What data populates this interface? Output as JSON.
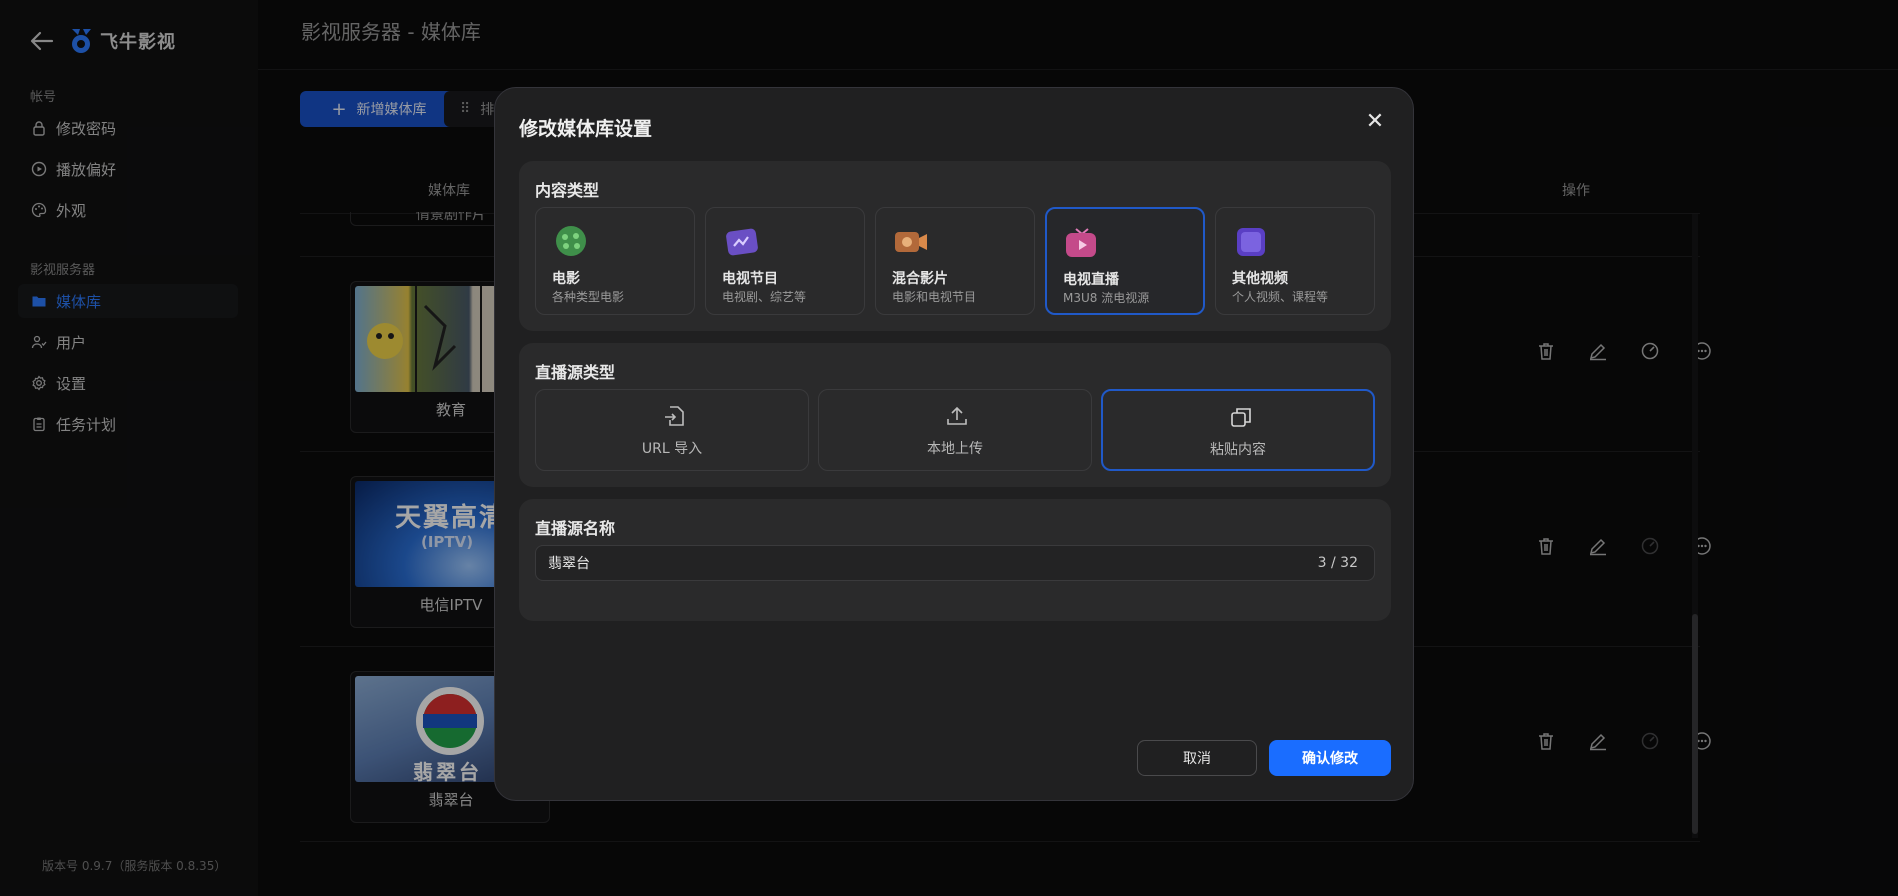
{
  "app": {
    "name": "飞牛影视",
    "version": "版本号 0.9.7（服务版本 0.8.35）"
  },
  "sidebar": {
    "account_label": "帐号",
    "server_label": "影视服务器",
    "items": [
      {
        "label": "修改密码",
        "icon": "lock-icon"
      },
      {
        "label": "播放偏好",
        "icon": "play-circle-icon"
      },
      {
        "label": "外观",
        "icon": "palette-icon"
      },
      {
        "label": "媒体库",
        "icon": "folder-icon",
        "active": true
      },
      {
        "label": "用户",
        "icon": "users-icon"
      },
      {
        "label": "设置",
        "icon": "gear-icon"
      },
      {
        "label": "任务计划",
        "icon": "clipboard-icon"
      }
    ]
  },
  "main": {
    "title": "影视服务器 - 媒体库",
    "add_button": "新增媒体库",
    "sort_button": "排",
    "columns": {
      "library": "媒体库",
      "actions": "操作"
    },
    "partial_row_label": "情景剧作片",
    "libraries": [
      {
        "name": "教育"
      },
      {
        "name": "电信IPTV",
        "poster_text": "天翼高清",
        "poster_sub": "(IPTV)"
      },
      {
        "name": "翡翠台",
        "poster_text": "翡翠台"
      }
    ]
  },
  "modal": {
    "title": "修改媒体库设置",
    "content_type_title": "内容类型",
    "content_types": [
      {
        "name": "电影",
        "desc": "各种类型电影",
        "icon": "movie-icon",
        "color": "#3f8f4a"
      },
      {
        "name": "电视节目",
        "desc": "电视剧、综艺等",
        "icon": "tv-show-icon",
        "color": "#6a4fc4"
      },
      {
        "name": "混合影片",
        "desc": "电影和电视节目",
        "icon": "camera-icon",
        "color": "#b2693a"
      },
      {
        "name": "电视直播",
        "desc": "M3U8 流电视源",
        "icon": "live-tv-icon",
        "color": "#c44a8a",
        "selected": true
      },
      {
        "name": "其他视频",
        "desc": "个人视频、课程等",
        "icon": "video-icon",
        "color": "#5a3fc4"
      }
    ],
    "source_type_title": "直播源类型",
    "source_types": [
      {
        "name": "URL 导入",
        "icon": "import-icon"
      },
      {
        "name": "本地上传",
        "icon": "upload-icon"
      },
      {
        "name": "粘贴内容",
        "icon": "paste-icon",
        "selected": true
      }
    ],
    "source_name_title": "直播源名称",
    "source_name_value": "翡翠台",
    "source_name_counter": "3 / 32",
    "cancel": "取消",
    "confirm": "确认修改"
  },
  "colors": {
    "accent": "#1a6dff",
    "selected_border": "#2059c8",
    "modal_bg": "#202021",
    "panel_bg": "#2a2a2b"
  }
}
